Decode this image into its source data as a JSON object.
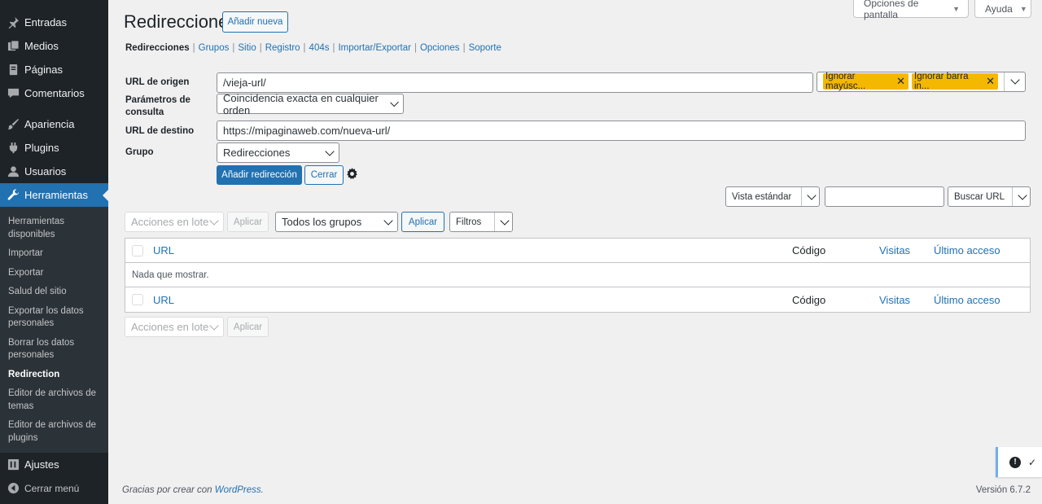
{
  "sidebar": {
    "items_top": [
      {
        "label": "Entradas",
        "icon": "pin-icon"
      },
      {
        "label": "Medios",
        "icon": "media-icon"
      },
      {
        "label": "Páginas",
        "icon": "page-icon"
      },
      {
        "label": "Comentarios",
        "icon": "comment-icon"
      }
    ],
    "items_mid": [
      {
        "label": "Apariencia",
        "icon": "brush-icon"
      },
      {
        "label": "Plugins",
        "icon": "plugin-icon"
      },
      {
        "label": "Usuarios",
        "icon": "user-icon"
      },
      {
        "label": "Herramientas",
        "icon": "wrench-icon"
      }
    ],
    "submenu": [
      "Herramientas disponibles",
      "Importar",
      "Exportar",
      "Salud del sitio",
      "Exportar los datos personales",
      "Borrar los datos personales",
      "Redirection",
      "Editor de archivos de temas",
      "Editor de archivos de plugins"
    ],
    "ajustes": "Ajustes",
    "collapse": "Cerrar menú"
  },
  "topbar": {
    "screen_options": "Opciones de pantalla",
    "help": "Ayuda"
  },
  "page": {
    "title": "Redirecciones",
    "add_new": "Añadir nueva"
  },
  "subnav": [
    "Redirecciones",
    "Grupos",
    "Sitio",
    "Registro",
    "404s",
    "Importar/Exportar",
    "Opciones",
    "Soporte"
  ],
  "form": {
    "source_label": "URL de origen",
    "source_value": "/vieja-url/",
    "flag_case": "Ignorar mayúsc...",
    "flag_slash": "Ignorar barra in...",
    "query_label": "Parámetros de consulta",
    "query_value": "Coincidencia exacta en cualquier orden",
    "target_label": "URL de destino",
    "target_value": "https://mipaginaweb.com/nueva-url/",
    "group_label": "Grupo",
    "group_value": "Redirecciones",
    "add_button": "Añadir redirección",
    "close_button": "Cerrar"
  },
  "search": {
    "view_value": "Vista estándar",
    "search_value": "",
    "search_button": "Buscar URL"
  },
  "tablenav": {
    "bulk_actions": "Acciones en lote",
    "apply": "Aplicar",
    "group_filter": "Todos los grupos",
    "filters": "Filtros"
  },
  "table": {
    "headers": {
      "url": "URL",
      "code": "Código",
      "hits": "Visitas",
      "last": "Último acceso"
    },
    "empty": "Nada que mostrar."
  },
  "footer": {
    "thanks": "Gracias por crear con ",
    "wp_link": "WordPress",
    "period": ".",
    "version": "Versión 6.7.2"
  }
}
